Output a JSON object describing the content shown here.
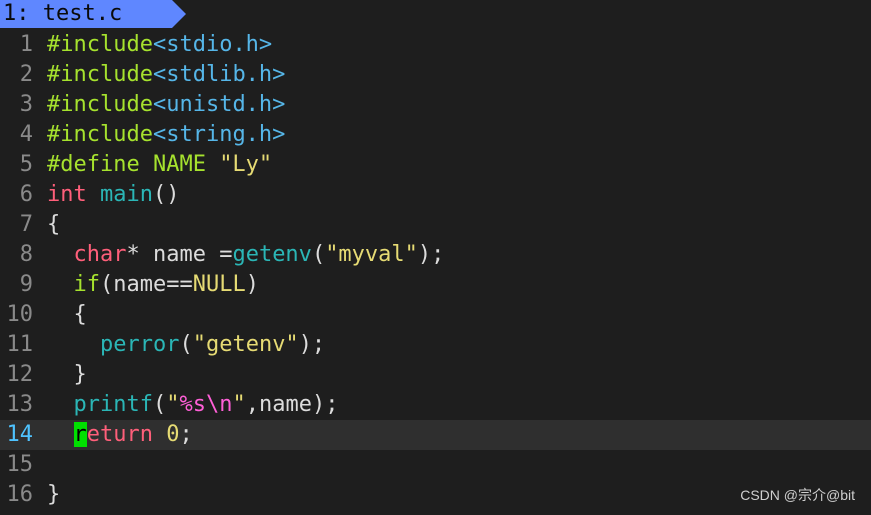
{
  "tab": {
    "label": "1: test.c"
  },
  "lines": [
    {
      "n": "1",
      "tokens": [
        [
          "#include",
          "pre"
        ],
        [
          "<stdio.h>",
          "hdr"
        ]
      ]
    },
    {
      "n": "2",
      "tokens": [
        [
          "#include",
          "pre"
        ],
        [
          "<stdlib.h>",
          "hdr"
        ]
      ]
    },
    {
      "n": "3",
      "tokens": [
        [
          "#include",
          "pre"
        ],
        [
          "<unistd.h>",
          "hdr"
        ]
      ]
    },
    {
      "n": "4",
      "tokens": [
        [
          "#include",
          "pre"
        ],
        [
          "<string.h>",
          "hdr"
        ]
      ]
    },
    {
      "n": "5",
      "tokens": [
        [
          "#define NAME ",
          "pre"
        ],
        [
          "\"Ly\"",
          "str"
        ]
      ]
    },
    {
      "n": "6",
      "tokens": [
        [
          "int",
          "kw"
        ],
        [
          " ",
          "plain"
        ],
        [
          "main",
          "fn"
        ],
        [
          "()",
          "plain"
        ]
      ]
    },
    {
      "n": "7",
      "tokens": [
        [
          "{",
          "plain"
        ]
      ]
    },
    {
      "n": "8",
      "tokens": [
        [
          "  ",
          "plain"
        ],
        [
          "char",
          "kw"
        ],
        [
          "* name =",
          "plain"
        ],
        [
          "getenv",
          "fn"
        ],
        [
          "(",
          "plain"
        ],
        [
          "\"myval\"",
          "str"
        ],
        [
          ");",
          "plain"
        ]
      ]
    },
    {
      "n": "9",
      "tokens": [
        [
          "  ",
          "plain"
        ],
        [
          "if",
          "pre"
        ],
        [
          "(name==",
          "plain"
        ],
        [
          "NULL",
          "const"
        ],
        [
          ")",
          "plain"
        ]
      ]
    },
    {
      "n": "10",
      "tokens": [
        [
          "  {",
          "plain"
        ]
      ]
    },
    {
      "n": "11",
      "tokens": [
        [
          "    ",
          "plain"
        ],
        [
          "perror",
          "fn"
        ],
        [
          "(",
          "plain"
        ],
        [
          "\"getenv\"",
          "str"
        ],
        [
          ");",
          "plain"
        ]
      ]
    },
    {
      "n": "12",
      "tokens": [
        [
          "  }",
          "plain"
        ]
      ]
    },
    {
      "n": "13",
      "tokens": [
        [
          "  ",
          "plain"
        ],
        [
          "printf",
          "fn"
        ],
        [
          "(",
          "plain"
        ],
        [
          "\"",
          "str"
        ],
        [
          "%s\\n",
          "esc"
        ],
        [
          "\"",
          "str"
        ],
        [
          ",name);",
          "plain"
        ]
      ]
    },
    {
      "n": "14",
      "current": true,
      "tokens": [
        [
          "  ",
          "plain"
        ],
        [
          "r",
          "cursor"
        ],
        [
          "eturn",
          "kw"
        ],
        [
          " ",
          "plain"
        ],
        [
          "0",
          "num"
        ],
        [
          ";",
          "plain"
        ]
      ]
    },
    {
      "n": "15",
      "tokens": []
    },
    {
      "n": "16",
      "tokens": [
        [
          "}",
          "plain"
        ]
      ]
    }
  ],
  "watermark": "CSDN @宗介@bit",
  "colors": {
    "background": "#1e1e1e",
    "tab_bg": "#5f87ff",
    "current_line_bg": "#2f2f2f",
    "current_line_number": "#4fc3ff",
    "cursor": "#00e000"
  }
}
